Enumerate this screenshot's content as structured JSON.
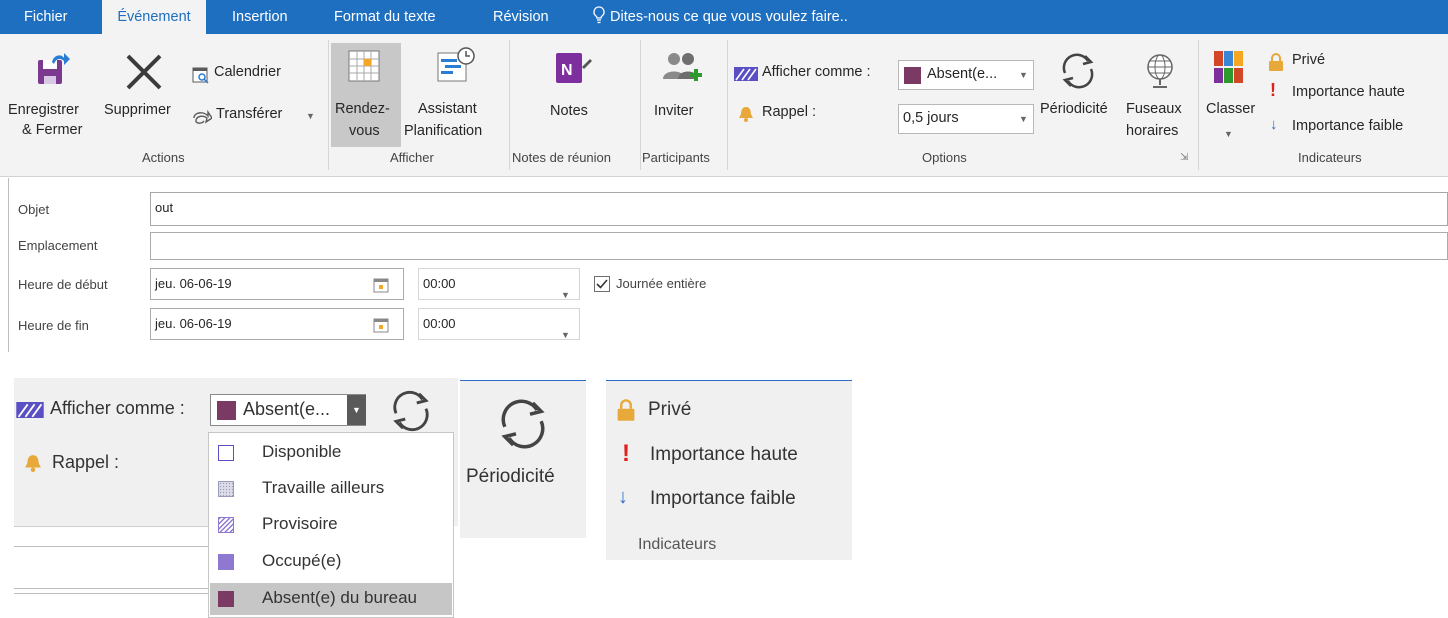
{
  "tabs": {
    "fichier": "Fichier",
    "evenement": "Événement",
    "insertion": "Insertion",
    "format": "Format du texte",
    "revision": "Révision",
    "tell_me": "Dites-nous ce que vous voulez faire.."
  },
  "ribbon": {
    "actions": {
      "save_line1": "Enregistrer",
      "save_line2": "& Fermer",
      "delete": "Supprimer",
      "calendar": "Calendrier",
      "forward": "Transférer",
      "group": "Actions"
    },
    "afficher": {
      "rdv_line1": "Rendez-",
      "rdv_line2": "vous",
      "assistant_line1": "Assistant",
      "assistant_line2": "Planification",
      "group": "Afficher"
    },
    "notes": {
      "label": "Notes",
      "group": "Notes de réunion"
    },
    "participants": {
      "label": "Inviter",
      "group": "Participants"
    },
    "options": {
      "show_as_label": "Afficher comme :",
      "show_as_value": "Absent(e...",
      "reminder_label": "Rappel :",
      "reminder_value": "0,5 jours",
      "recurrence": "Périodicité",
      "tz_line1": "Fuseaux",
      "tz_line2": "horaires",
      "group": "Options"
    },
    "classer": {
      "label": "Classer"
    },
    "indicateurs": {
      "private": "Privé",
      "high": "Importance haute",
      "low": "Importance faible",
      "group": "Indicateurs"
    }
  },
  "form": {
    "subject_label": "Objet",
    "subject_value": "out",
    "location_label": "Emplacement",
    "location_value": "",
    "start_label": "Heure de début",
    "start_date": "jeu. 06-06-19",
    "start_time": "00:00",
    "allday_label": "Journée entière",
    "allday_checked": true,
    "end_label": "Heure de fin",
    "end_date": "jeu. 06-06-19",
    "end_time": "00:00"
  },
  "zoom": {
    "show_as_label": "Afficher comme :",
    "show_as_value": "Absent(e...",
    "reminder_label": "Rappel :",
    "recurrence": "Périodicité",
    "menu": [
      {
        "label": "Disponible",
        "color": "#ffffff"
      },
      {
        "label": "Travaille ailleurs",
        "color": "#dcdce8"
      },
      {
        "label": "Provisoire",
        "color": "#b9a8e0"
      },
      {
        "label": "Occupé(e)",
        "color": "#8f78d0"
      },
      {
        "label": "Absent(e) du bureau",
        "color": "#7b3a63"
      }
    ],
    "private": "Privé",
    "high": "Importance haute",
    "low": "Importance faible",
    "group": "Indicateurs"
  },
  "colors": {
    "accent": "#1e6fc0",
    "away": "#7b3a63",
    "busy": "#8f78d0",
    "lock": "#e8a93a",
    "exclaim": "#e0201a"
  }
}
